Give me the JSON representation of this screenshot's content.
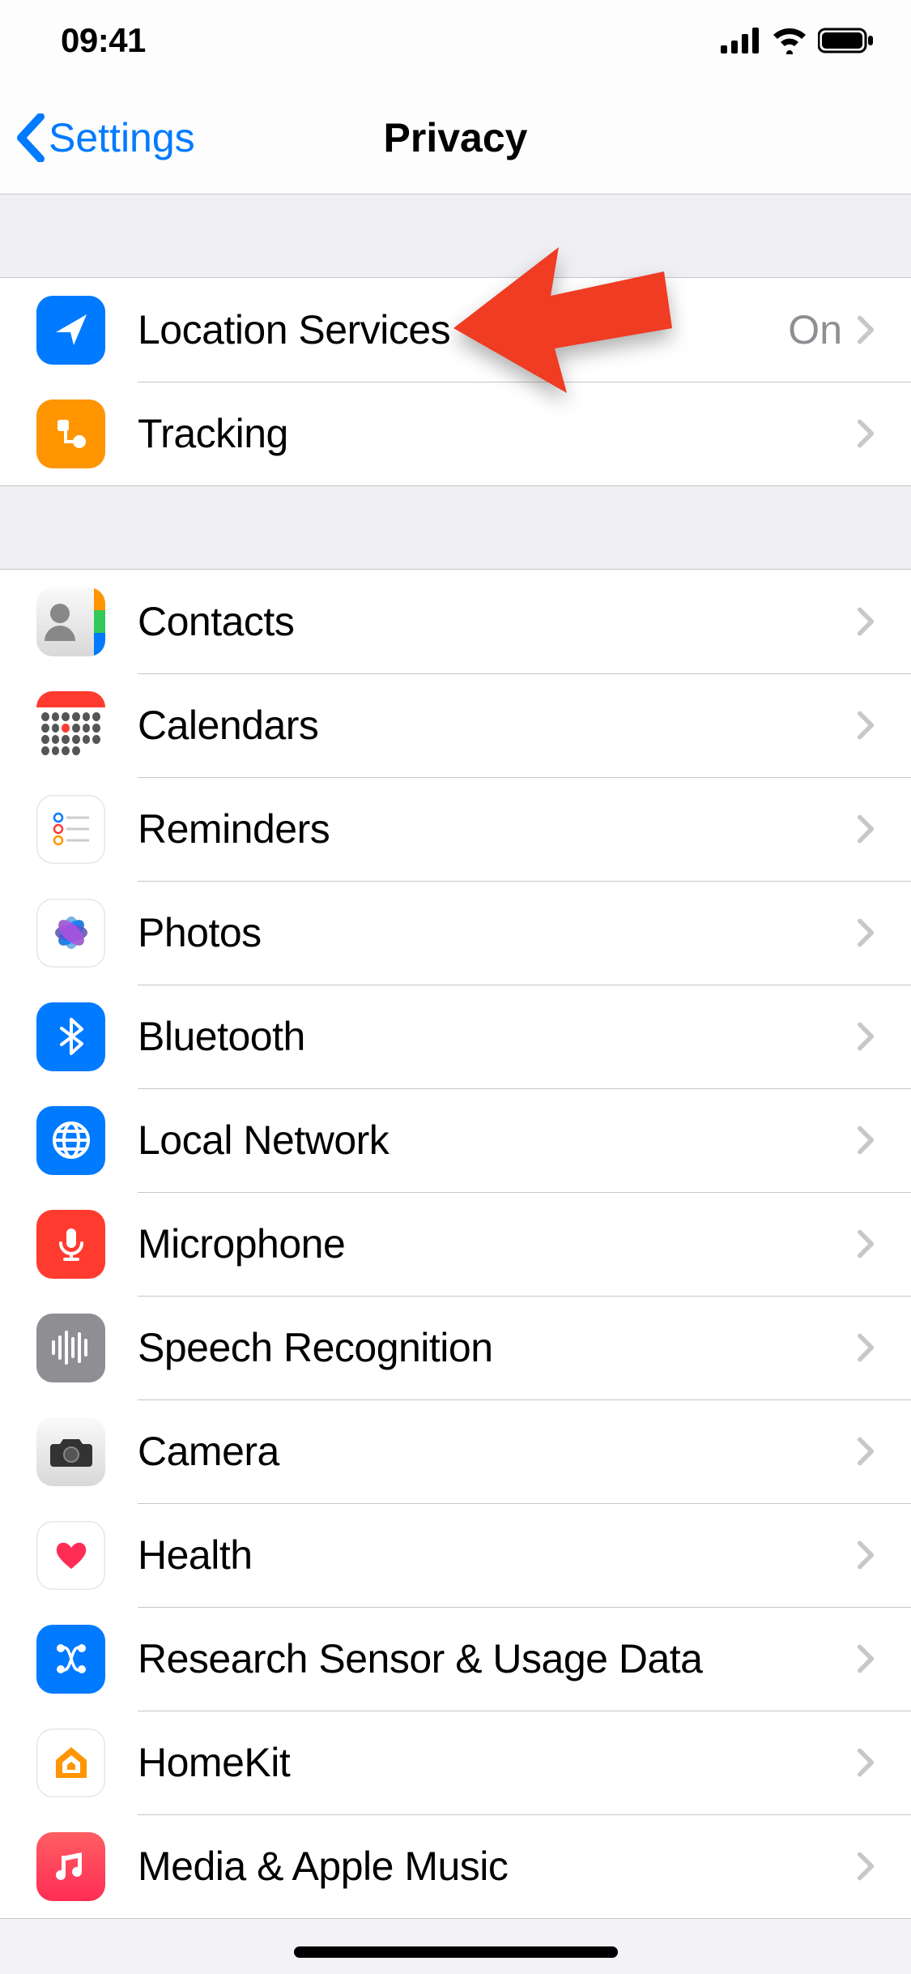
{
  "status": {
    "time": "09:41"
  },
  "nav": {
    "back_label": "Settings",
    "title": "Privacy"
  },
  "sections": [
    {
      "rows": [
        {
          "icon": "location-arrow-icon",
          "key": "location_services",
          "label": "Location Services",
          "value": "On"
        },
        {
          "icon": "tracking-icon",
          "key": "tracking",
          "label": "Tracking"
        }
      ]
    },
    {
      "rows": [
        {
          "icon": "contacts-icon",
          "key": "contacts",
          "label": "Contacts"
        },
        {
          "icon": "calendars-icon",
          "key": "calendars",
          "label": "Calendars"
        },
        {
          "icon": "reminders-icon",
          "key": "reminders",
          "label": "Reminders"
        },
        {
          "icon": "photos-icon",
          "key": "photos",
          "label": "Photos"
        },
        {
          "icon": "bluetooth-icon",
          "key": "bluetooth",
          "label": "Bluetooth"
        },
        {
          "icon": "network-icon",
          "key": "local_network",
          "label": "Local Network"
        },
        {
          "icon": "microphone-icon",
          "key": "microphone",
          "label": "Microphone"
        },
        {
          "icon": "speech-icon",
          "key": "speech",
          "label": "Speech Recognition"
        },
        {
          "icon": "camera-icon",
          "key": "camera",
          "label": "Camera"
        },
        {
          "icon": "health-icon",
          "key": "health",
          "label": "Health"
        },
        {
          "icon": "research-icon",
          "key": "research",
          "label": "Research Sensor & Usage Data"
        },
        {
          "icon": "homekit-icon",
          "key": "homekit",
          "label": "HomeKit"
        },
        {
          "icon": "media-icon",
          "key": "media",
          "label": "Media & Apple Music"
        }
      ]
    }
  ],
  "annotation": {
    "type": "pointer-arrow",
    "target": "location_services"
  },
  "colors": {
    "tint": "#007aff",
    "separator": "#c6c6c8",
    "group_bg": "#efeff4",
    "secondary_label": "#8e8e93",
    "annotation": "#ef3c23"
  }
}
